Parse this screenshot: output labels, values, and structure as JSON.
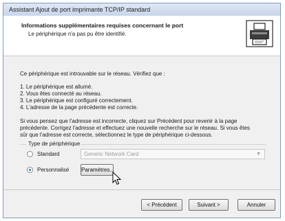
{
  "window": {
    "title": "Assistant Ajout de port imprimante TCP/IP standard"
  },
  "header": {
    "title": "Informations supplémentaires requises concernant le port",
    "subtitle": "Le périphérique n'a pas pu être identifié.",
    "icon": "network-printer-icon"
  },
  "body": {
    "intro": "Ce périphérique est introuvable sur le réseau. Vérifiez que :",
    "checklist": [
      "1.  Le périphérique est allumé.",
      "2.  Vous êtes connecté au réseau.",
      "3.  Le périphérique est configuré correctement.",
      "4.  L'adresse de la page précédente est correcte."
    ],
    "advice_lines": [
      "Si vous pensez que l'adresse est incorrecte, cliquez sur Précédent pour revenir à la page",
      "précédente. Corrigez l'adresse et effectuez une nouvelle recherche sur le réseau. Si vous êtes",
      "sûr que l'adresse est correcte, sélectionnez le type de périphérique ci-dessous."
    ]
  },
  "device_type": {
    "label": "Type de périphérique",
    "standard_label": "Standard",
    "standard_selected": false,
    "standard_value": "Generic Network Card",
    "custom_label": "Personnalisé",
    "custom_selected": true,
    "settings_button": "Paramètres..."
  },
  "footer": {
    "back_button": "< Précédent",
    "next_button": "Suivant >",
    "cancel_button": "Annuler"
  }
}
